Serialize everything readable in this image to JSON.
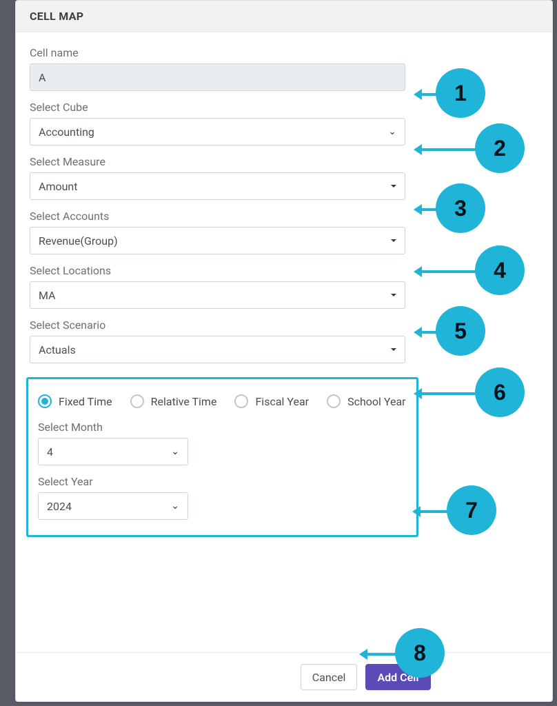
{
  "header": {
    "title": "CELL MAP"
  },
  "form": {
    "cellName": {
      "label": "Cell name",
      "value": "A"
    },
    "cube": {
      "label": "Select Cube",
      "value": "Accounting"
    },
    "measure": {
      "label": "Select Measure",
      "value": "Amount"
    },
    "accounts": {
      "label": "Select Accounts",
      "value": "Revenue(Group)"
    },
    "locations": {
      "label": "Select Locations",
      "value": "MA"
    },
    "scenario": {
      "label": "Select Scenario",
      "value": "Actuals"
    }
  },
  "time": {
    "options": [
      "Fixed Time",
      "Relative Time",
      "Fiscal Year",
      "School Year"
    ],
    "selected": "Fixed Time",
    "month": {
      "label": "Select Month",
      "value": "4"
    },
    "year": {
      "label": "Select Year",
      "value": "2024"
    }
  },
  "footer": {
    "cancel": "Cancel",
    "submit": "Add Cell"
  },
  "markers": [
    "1",
    "2",
    "3",
    "4",
    "5",
    "6",
    "7",
    "8"
  ]
}
